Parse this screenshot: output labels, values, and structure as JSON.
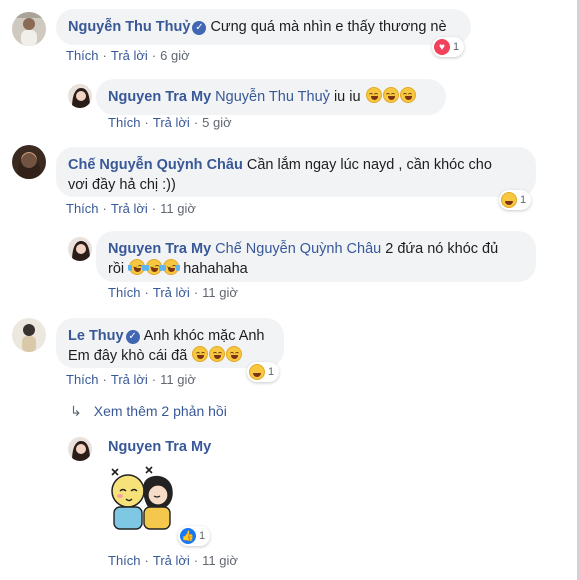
{
  "actions": {
    "like": "Thích",
    "reply": "Trả lời",
    "separator": "·"
  },
  "comments": [
    {
      "author": "Nguyễn Thu Thuỷ",
      "verified": true,
      "text": "Cưng quá mà nhìn e thấy thương nè",
      "time": "6 giờ",
      "reaction": {
        "icon": "love-icon",
        "count": "1"
      },
      "replies": [
        {
          "author": "Nguyen Tra My",
          "tag": "Nguyễn Thu Thuỷ",
          "text": "iu iu",
          "emojis": [
            "grin-emoji",
            "grin-emoji",
            "grin-emoji"
          ],
          "time": "5 giờ"
        }
      ]
    },
    {
      "author": "Chế Nguyễn Quỳnh Châu",
      "verified": false,
      "text_line1": "Cần lắm ngay lúc nayd , cần khóc cho",
      "text_line2": "vơi đầy hả chị :))",
      "time": "11 giờ",
      "reaction": {
        "icon": "haha-icon",
        "count": "1"
      },
      "replies": [
        {
          "author": "Nguyen Tra My",
          "tag": "Chế Nguyễn Quỳnh Châu",
          "text_line1": "2 đứa nó khóc đủ",
          "text_line2_prefix": "rồi",
          "text_line2_suffix": "hahahaha",
          "emojis": [
            "rofl-emoji",
            "rofl-emoji",
            "rofl-emoji"
          ],
          "time": "11 giờ"
        }
      ]
    },
    {
      "author": "Le Thuy",
      "verified": true,
      "text_line1": "Anh khóc mặc Anh",
      "text_line2": "Em đây khò cái đã",
      "emojis": [
        "smile-emoji",
        "smile-emoji",
        "smile-emoji"
      ],
      "time": "11 giờ",
      "reaction": {
        "icon": "haha-icon",
        "count": "1"
      },
      "more_replies": "Xem thêm 2 phản hồi",
      "replies": [
        {
          "author": "Nguyen Tra My",
          "sticker": "hugging-kids-sticker",
          "time": "11 giờ",
          "reaction": {
            "icon": "like-icon",
            "count": "1"
          }
        }
      ]
    }
  ]
}
